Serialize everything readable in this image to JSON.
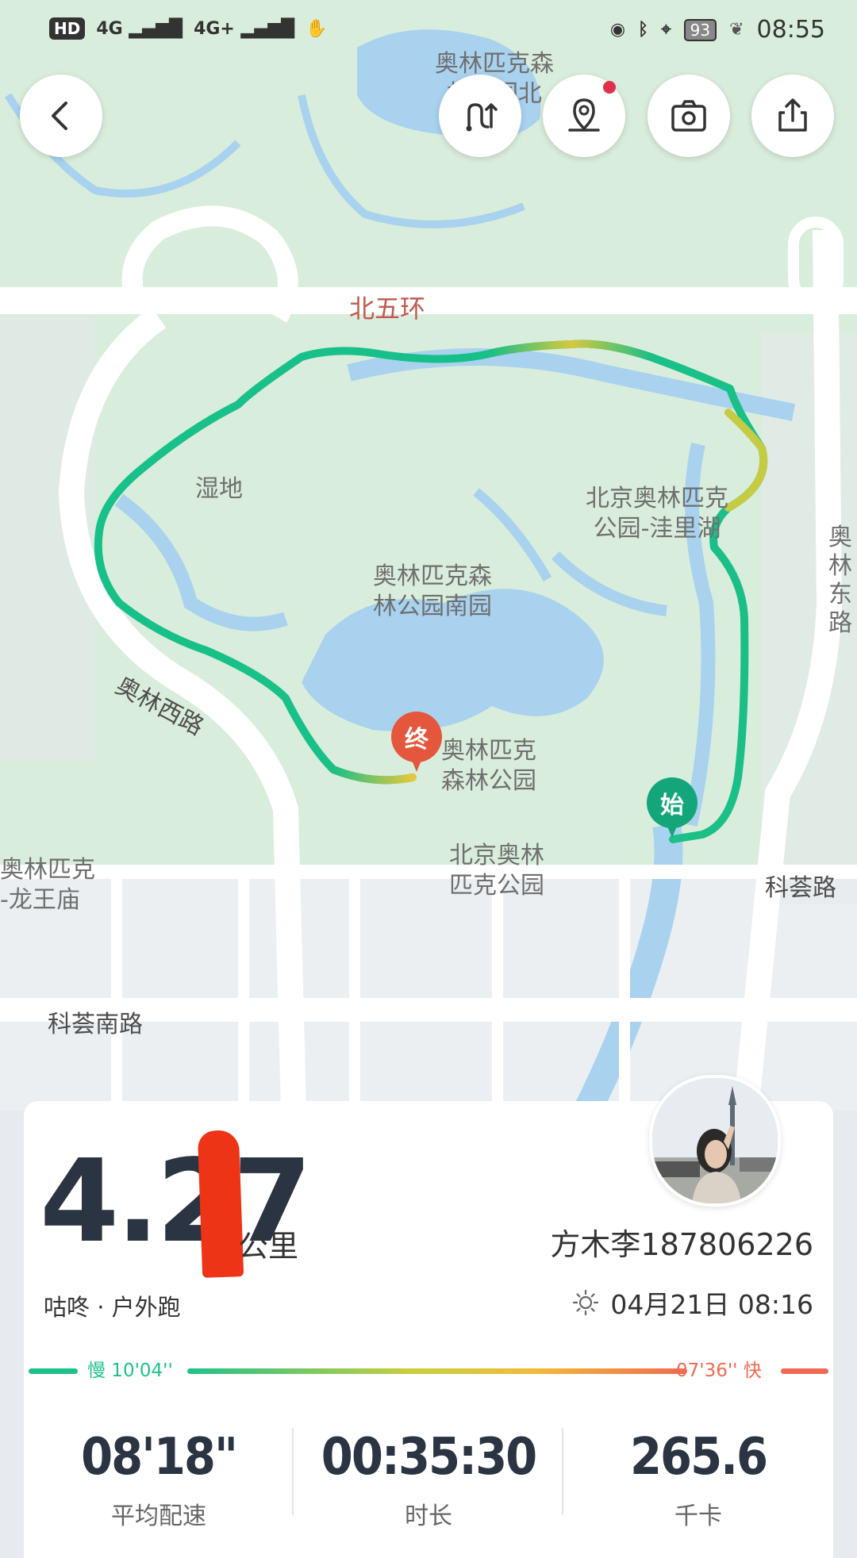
{
  "status_bar": {
    "network": "HD",
    "signal_1": "4G",
    "signal_2": "4G+",
    "battery": "93",
    "time": "08:55"
  },
  "toolbar": {
    "back_icon": "chevron-left-icon",
    "route_icon": "route-icon",
    "location_icon": "location-pin-icon",
    "camera_icon": "camera-icon",
    "share_icon": "share-icon",
    "has_notification": true
  },
  "map": {
    "labels": {
      "olympic_north": "奥林匹克森\n林公园北",
      "north_5th_ring": "北五环",
      "wetland": "湿地",
      "wali_lake": "北京奥林匹克\n公园-洼里湖",
      "south_park": "奥林匹克森\n林公园南园",
      "olympic_west_rd": "奥林西路",
      "olympic_east_rd": "奥\n林\n东\n路",
      "forest_park": "奥林匹克\n森林公园",
      "beijing_olympic_park": "北京奥林\n匹克公园",
      "longwang_temple": "奥林匹克\n-龙王庙",
      "kehui_rd": "科荟路",
      "kehui_south_rd": "科荟南路"
    },
    "start_marker": "始",
    "end_marker": "终",
    "route_color_slow": "#17c08a",
    "route_color_fast": "#e8c43c"
  },
  "summary": {
    "distance": "4.27",
    "distance_unit": "公里",
    "activity": "咕咚 · 户外跑",
    "username": "方木李187806226",
    "weather_icon": "sun-icon",
    "date": "04月21日 08:16"
  },
  "pace_scale": {
    "slow_label": "慢 10'04''",
    "fast_label": "07'36'' 快",
    "slow_color": "#20c08b",
    "fast_color": "#ef6a52"
  },
  "stats": [
    {
      "value": "08'18\"",
      "label": "平均配速"
    },
    {
      "value": "00:35:30",
      "label": "时长"
    },
    {
      "value": "265.6",
      "label": "千卡"
    }
  ]
}
